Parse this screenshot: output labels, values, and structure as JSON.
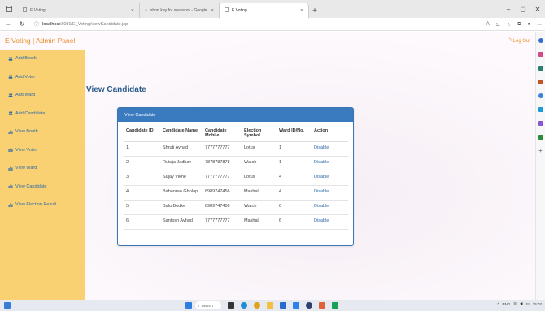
{
  "browser": {
    "tabs": [
      {
        "label": "E Voting",
        "active": false
      },
      {
        "label": "short key for snapshot - Google",
        "active": false
      },
      {
        "label": "E Voting",
        "active": true
      }
    ],
    "url_host": "localhost",
    "url_path": ":8080/E_Voting/viewCandidate.jsp"
  },
  "header": {
    "brand": "E Voting | Admin Panel",
    "logout": "Log Out"
  },
  "sidebar": {
    "items": [
      {
        "label": "Add Booth",
        "icon": "users-icon"
      },
      {
        "label": "Add Voter",
        "icon": "users-icon"
      },
      {
        "label": "Add Ward",
        "icon": "users-icon"
      },
      {
        "label": "Add Candidate",
        "icon": "users-icon"
      },
      {
        "label": "View Booth",
        "icon": "bar-chart-icon"
      },
      {
        "label": "View Voter",
        "icon": "bar-chart-icon"
      },
      {
        "label": "View Ward",
        "icon": "bar-chart-icon"
      },
      {
        "label": "View Candidate",
        "icon": "bar-chart-icon"
      },
      {
        "label": "View Election Result",
        "icon": "bar-chart-icon"
      }
    ]
  },
  "main": {
    "title": "View Candidate",
    "panel_title": "View Candidate",
    "columns": [
      "Candidate ID",
      "Candidate Name",
      "Candidate Mobile",
      "Election Symbol",
      "Ward ID/No.",
      "Action"
    ],
    "rows": [
      {
        "id": "1",
        "name": "Shruti Avhad",
        "mobile": "7777777777",
        "symbol": "Lotus",
        "ward": "1",
        "action": "Disable"
      },
      {
        "id": "2",
        "name": "Rutuja Jadhav",
        "mobile": "7878787878",
        "symbol": "Watch",
        "ward": "1",
        "action": "Disable"
      },
      {
        "id": "3",
        "name": "Sujay Vikhe",
        "mobile": "7777777777",
        "symbol": "Lotus",
        "ward": "4",
        "action": "Disable"
      },
      {
        "id": "4",
        "name": "Babanrao Gholap",
        "mobile": "8989747456",
        "symbol": "Mashal",
        "ward": "4",
        "action": "Disable"
      },
      {
        "id": "5",
        "name": "Balu Bodke",
        "mobile": "8989747456",
        "symbol": "Watch",
        "ward": "6",
        "action": "Disable"
      },
      {
        "id": "6",
        "name": "Santosh Avhad",
        "mobile": "7777777777",
        "symbol": "Mashal",
        "ward": "6",
        "action": "Disable"
      }
    ]
  },
  "taskbar": {
    "search": "Search",
    "lang": "ENG",
    "time": "15:02"
  },
  "colors": {
    "accent": "#e8902a",
    "sidebar": "#f9d173",
    "panel": "#3a7bc0",
    "link": "#2c6aa8"
  }
}
